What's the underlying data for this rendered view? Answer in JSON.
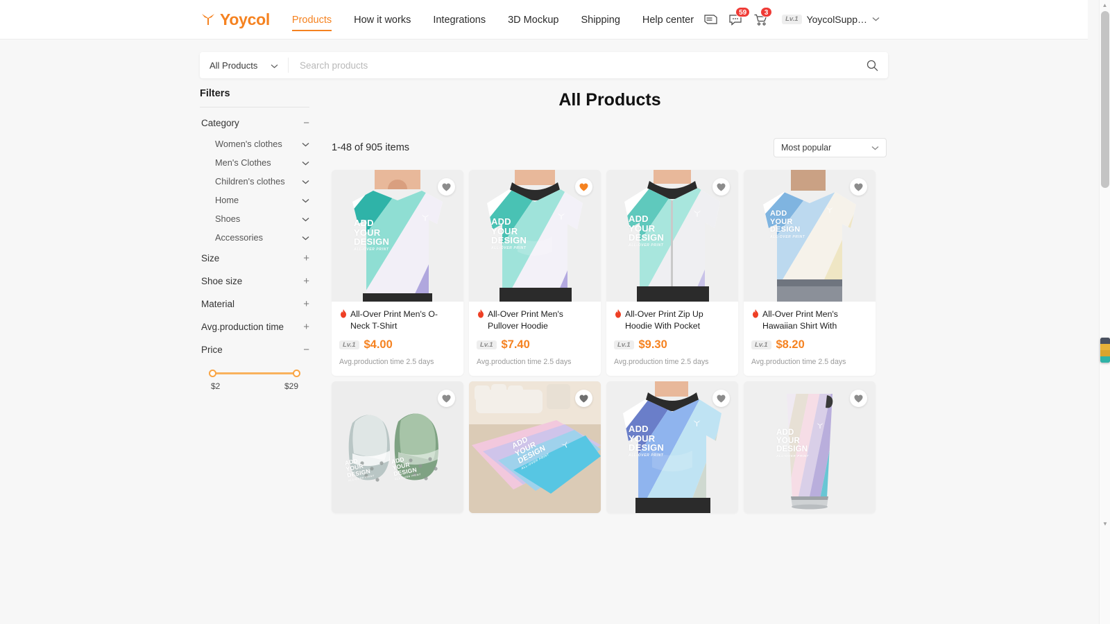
{
  "header": {
    "logo_text": "Yoycol",
    "logo_icon": "bird-logo-icon",
    "nav": [
      {
        "label": "Products",
        "active": true
      },
      {
        "label": "How it works",
        "active": false
      },
      {
        "label": "Integrations",
        "active": false
      },
      {
        "label": "3D Mockup",
        "active": false
      },
      {
        "label": "Shipping",
        "active": false
      },
      {
        "label": "Help center",
        "active": false
      }
    ],
    "icons": {
      "coupon": "coupon-icon",
      "message": "message-icon",
      "cart": "cart-icon"
    },
    "message_badge": "59",
    "cart_badge": "3",
    "user_level": "Lv.1",
    "user_name": "YoycolSupp…",
    "user_caret": "⌄"
  },
  "search": {
    "category_label": "All Products",
    "placeholder": "Search products",
    "value": "",
    "search_icon": "search-icon"
  },
  "sidebar": {
    "title": "Filters",
    "groups": [
      {
        "label": "Category",
        "state": "−",
        "expanded": true
      },
      {
        "label": "Size",
        "state": "+",
        "expanded": false
      },
      {
        "label": "Shoe size",
        "state": "+",
        "expanded": false
      },
      {
        "label": "Material",
        "state": "+",
        "expanded": false
      },
      {
        "label": "Avg.production time",
        "state": "+",
        "expanded": false
      },
      {
        "label": "Price",
        "state": "−",
        "expanded": true
      }
    ],
    "categories": [
      {
        "label": "Women's clothes"
      },
      {
        "label": "Men's Clothes"
      },
      {
        "label": "Children's clothes"
      },
      {
        "label": "Home"
      },
      {
        "label": "Shoes"
      },
      {
        "label": "Accessories"
      }
    ],
    "price": {
      "min_label": "$2",
      "max_label": "$29"
    }
  },
  "main": {
    "title": "All Products",
    "results_count": "1-48 of 905 items",
    "sort_label": "Most popular"
  },
  "products": [
    {
      "title": "All-Over Print Men's O-Neck T-Shirt",
      "level": "Lv.1",
      "price": "$4.00",
      "production": "Avg.production time 2.5 days",
      "favorited": false,
      "mock_text": "ADD YOUR DESIGN",
      "mock_sub": "ALL-OVER PRINT",
      "type": "tshirt"
    },
    {
      "title": "All-Over Print Men's Pullover Hoodie",
      "level": "Lv.1",
      "price": "$7.40",
      "production": "Avg.production time 2.5 days",
      "favorited": true,
      "mock_text": "ADD YOUR DESIGN",
      "mock_sub": "ALL-OVER PRINT",
      "type": "pullover"
    },
    {
      "title": "All-Over Print Zip Up Hoodie With Pocket",
      "level": "Lv.1",
      "price": "$9.30",
      "production": "Avg.production time 2.5 days",
      "favorited": false,
      "mock_text": "ADD YOUR DESIGN",
      "mock_sub": "ALL-OVER PRINT",
      "type": "zip"
    },
    {
      "title": "All-Over Print Men's Hawaiian Shirt With Button…",
      "level": "Lv.1",
      "price": "$8.20",
      "production": "Avg.production time 2.5 days",
      "favorited": false,
      "mock_text": "ADD YOUR DESIGN",
      "mock_sub": "ALL-OVER PRINT",
      "type": "hawaiian"
    },
    {
      "title": "",
      "level": "",
      "price": "",
      "production": "",
      "favorited": false,
      "mock_text": "ADD YOUR DESIGN",
      "mock_sub": "ALL-OVER PRINT",
      "type": "clogs"
    },
    {
      "title": "",
      "level": "",
      "price": "",
      "production": "",
      "favorited": false,
      "mock_text": "ADD YOUR DESIGN",
      "mock_sub": "ALL-OVER PRINT",
      "type": "rug"
    },
    {
      "title": "",
      "level": "",
      "price": "",
      "production": "",
      "favorited": false,
      "mock_text": "ADD YOUR DESIGN",
      "mock_sub": "ALL-OVER PRINT",
      "type": "hoodie2"
    },
    {
      "title": "",
      "level": "",
      "price": "",
      "production": "",
      "favorited": false,
      "mock_text": "ADD YOUR DESIGN",
      "mock_sub": "ALL-OVER PRINT",
      "type": "tumbler"
    }
  ],
  "colors": {
    "brand_orange": "#F58220",
    "badge_red": "#ef3b36",
    "page_bg": "#f7f7f7"
  }
}
